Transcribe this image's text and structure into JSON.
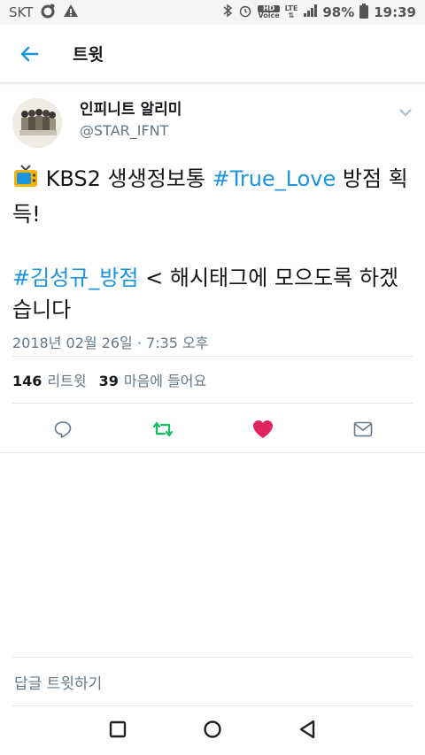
{
  "status_bar": {
    "carrier": "SKT",
    "hd_label": "HD",
    "voice_label": "Voice",
    "lte_label": "LTE",
    "battery": "98%",
    "time": "19:39"
  },
  "header": {
    "title": "트윗"
  },
  "tweet": {
    "display_name": "인피니트 알리미",
    "handle": "@STAR_IFNT",
    "line1_prefix": " KBS2 생생정보통 ",
    "line1_hashtag": "#True_Love",
    "line1_suffix": " 방점 획득!",
    "line2_hashtag": "#김성규_방점",
    "line2_suffix": " < 해시태그에 모으도록 하겠습니다",
    "timestamp": "2018년 02월 26일 · 7:35 오후",
    "retweet_count": "146",
    "retweet_label": "리트윗",
    "like_count": "39",
    "like_label": "마음에 들어요"
  },
  "reply_bar": {
    "placeholder": "답글 트윗하기"
  },
  "colors": {
    "accent": "#1b95e0",
    "retweet": "#17bf63",
    "like": "#e0245e"
  }
}
